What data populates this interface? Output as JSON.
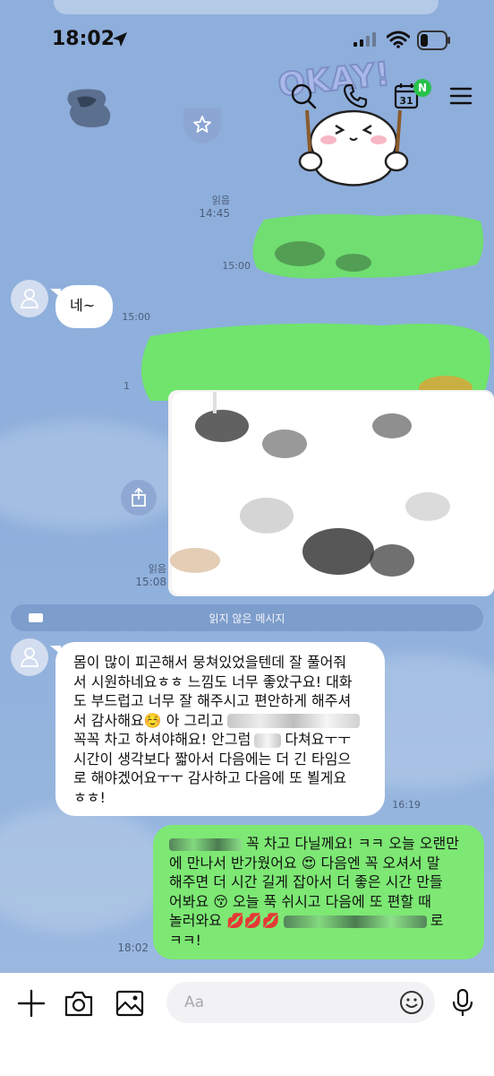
{
  "status_bar": {
    "time": "18:02"
  },
  "header": {
    "calendar_day": "31",
    "calendar_badge": "N",
    "sticker_logo_text": "OKAY!"
  },
  "messages": [
    {
      "id": "ts-1",
      "read": "읽음",
      "time": "14:45"
    },
    {
      "id": "ts-2",
      "time": "15:00"
    },
    {
      "id": "msg-ne",
      "from": "other",
      "text": "네~",
      "time": "15:00"
    },
    {
      "id": "ts-4",
      "read": "읽음",
      "time": "15:08"
    },
    {
      "id": "msg-long",
      "from": "other",
      "lines": [
        "몸이 많이 피곤해서 뭉쳐있었을텐데 잘 풀어줘",
        "서 시원하네요ㅎㅎ 느낌도 너무 좋았구요! 대화",
        "도 부드럽고 너무 잘 해주시고 편안하게 해주셔",
        "서 감사해요☺️ 아 그리고",
        "꼭꼭 차고 하셔야해요! 안그럼",
        "다쳐요ㅜㅜ",
        "시간이 생각보다 짧아서 다음에는 더 긴 타임으",
        "로 해야겠어요ㅜㅜ 감사하고 다음에 또 뵐게요",
        "ㅎㅎ!"
      ],
      "time": "16:19"
    },
    {
      "id": "msg-reply",
      "from": "me",
      "lines": [
        "꼭 차고 다닐께요! ㅋㅋ 오늘 오랜만",
        "에 만나서 반가웠어요 😍 다음엔 꼭 오셔서 말",
        "해주면 더 시간 길게 잡아서 더 좋은 시간 만들",
        "어봐요 😚 오늘 푹 쉬시고 다음에 또 편할 때",
        "놀러와요 💋💋💋",
        "로",
        "ㅋㅋ!"
      ],
      "time": "18:02"
    }
  ],
  "unread_divider": "읽지 않은 메시지",
  "input": {
    "placeholder": "Aa"
  }
}
